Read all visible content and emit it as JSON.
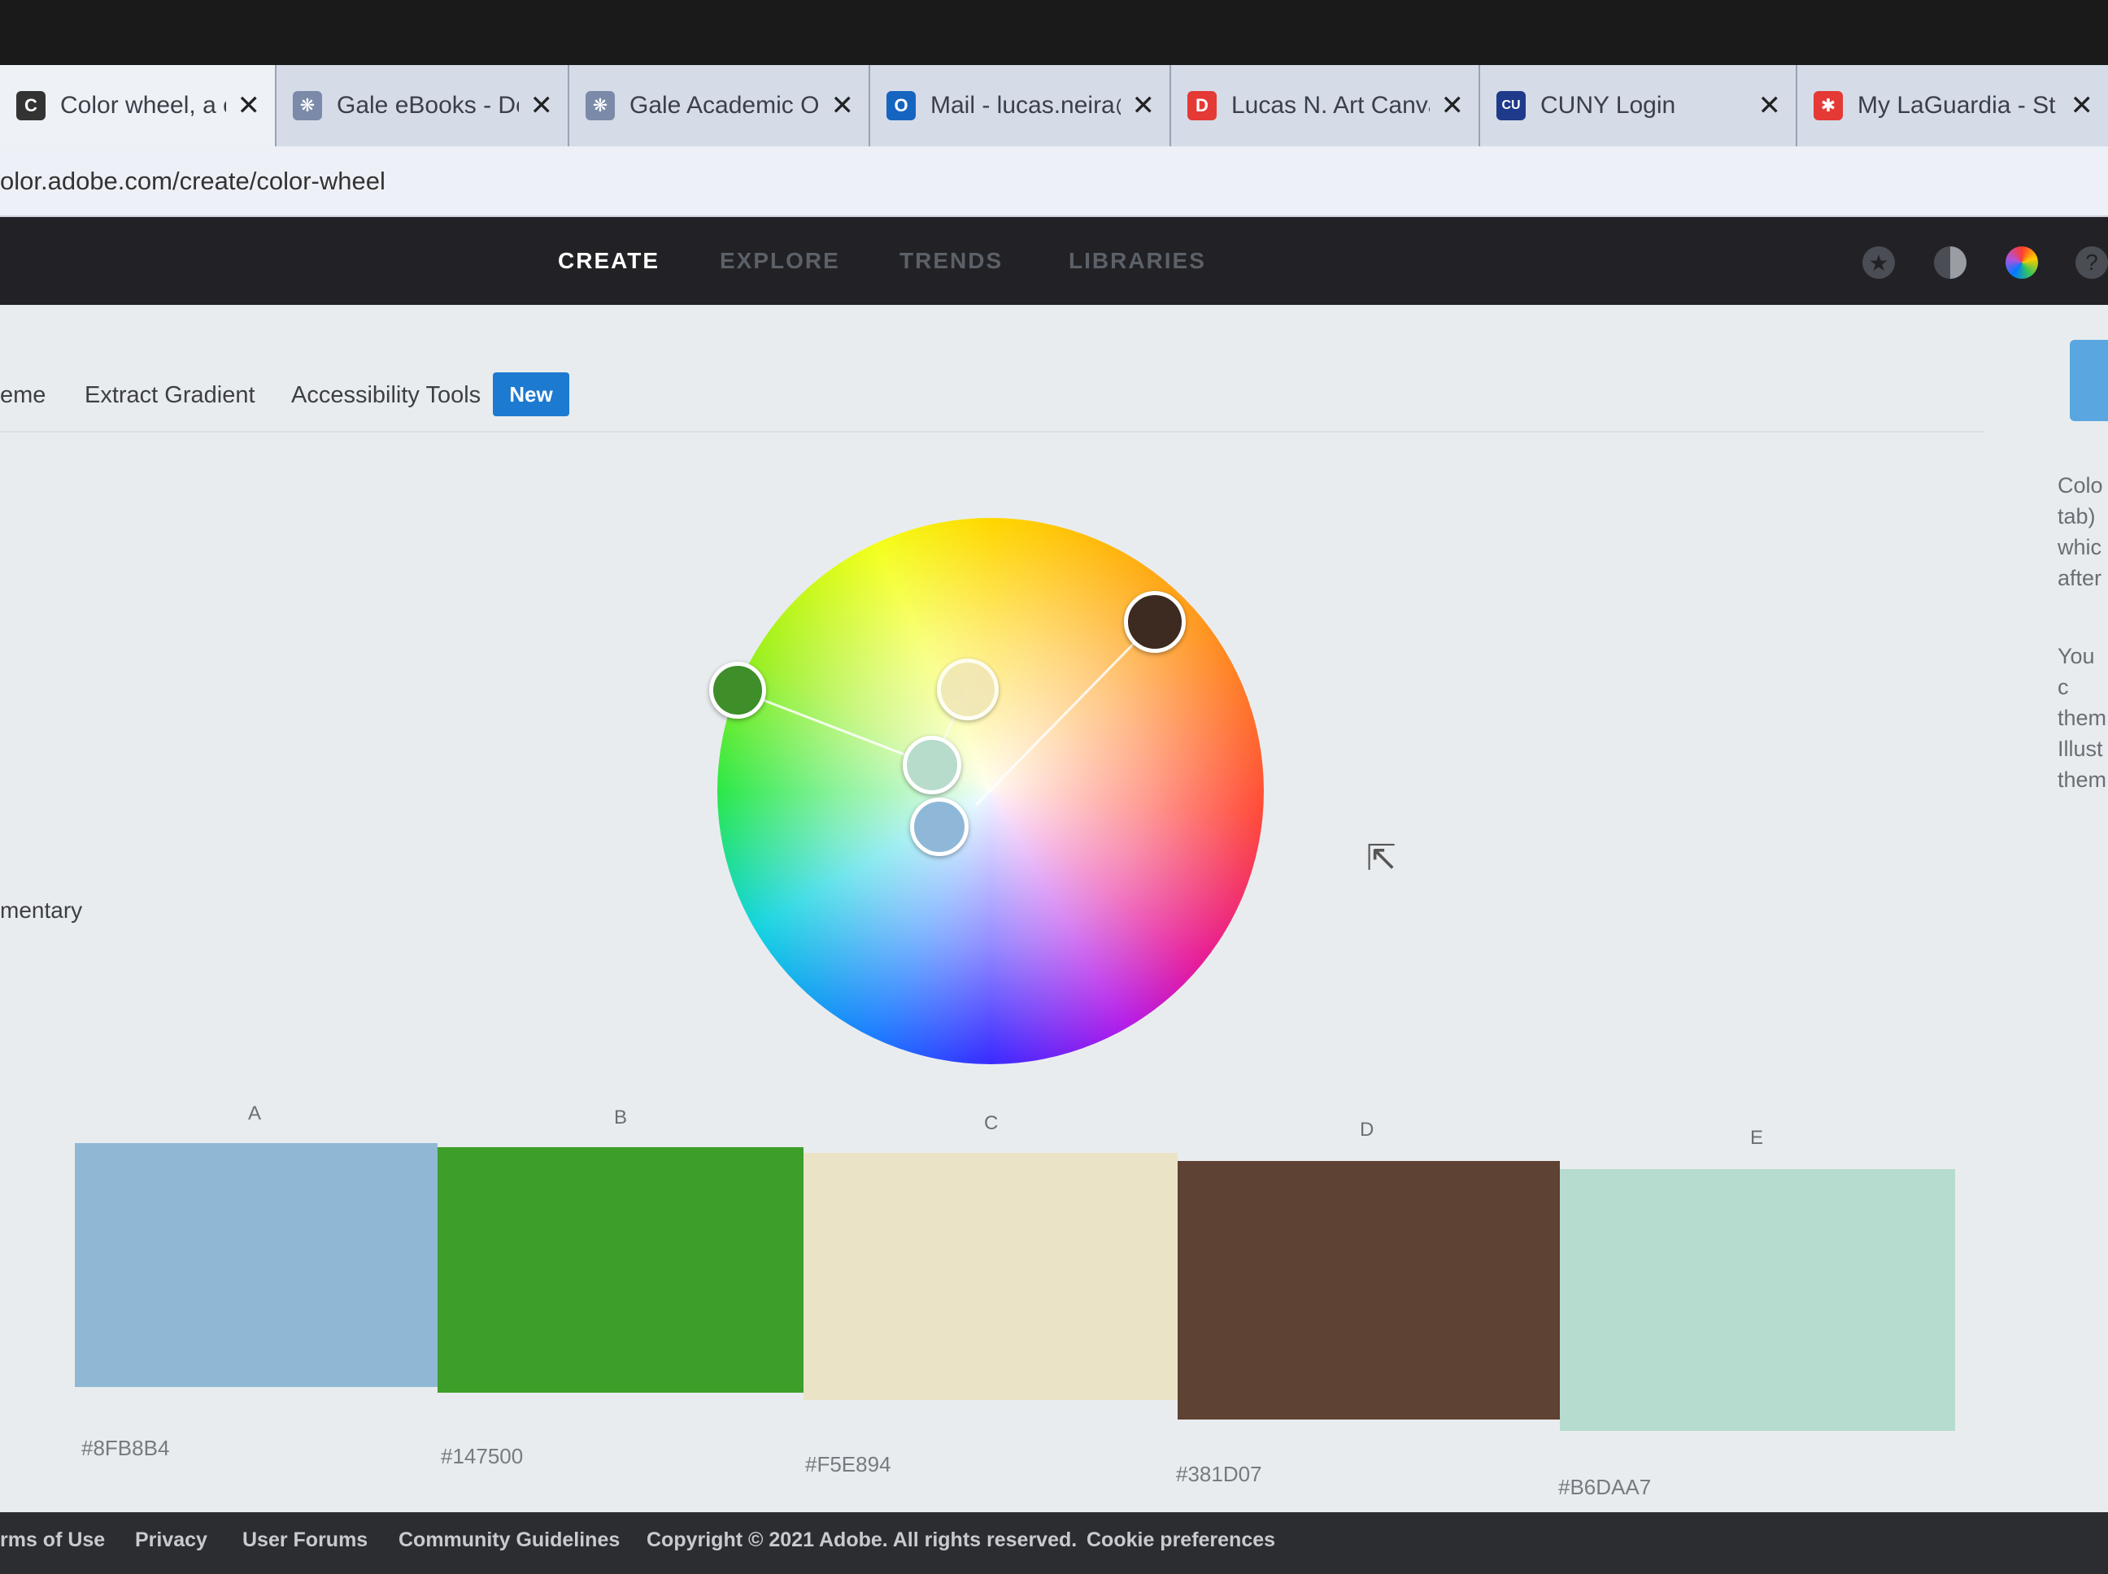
{
  "browser": {
    "tabs": [
      {
        "title": "Color wheel, a colc",
        "favicon": "adobe-color-favicon",
        "fav_color": "#333333",
        "fav_char": "C",
        "active": true
      },
      {
        "title": "Gale eBooks - Doc",
        "favicon": "gale-favicon",
        "fav_color": "#7a8aa8",
        "fav_char": "❋",
        "active": false
      },
      {
        "title": "Gale Academic On",
        "favicon": "gale-favicon",
        "fav_color": "#7a8aa8",
        "fav_char": "❋",
        "active": false
      },
      {
        "title": "Mail - lucas.neira@",
        "favicon": "outlook-favicon",
        "fav_color": "#1565c0",
        "fav_char": "O",
        "active": false
      },
      {
        "title": "Lucas N. Art Canva",
        "favicon": "d-favicon",
        "fav_color": "#e53935",
        "fav_char": "D",
        "active": false
      },
      {
        "title": "CUNY Login",
        "favicon": "cuny-favicon",
        "fav_color": "#1f3a8a",
        "fav_char": "CU",
        "active": false
      },
      {
        "title": "My LaGuardia - St",
        "favicon": "laguardia-favicon",
        "fav_color": "#e53935",
        "fav_char": "✱",
        "active": false
      }
    ],
    "close_glyph": "✕",
    "url": "olor.adobe.com/create/color-wheel"
  },
  "nav": {
    "items": [
      "CREATE",
      "EXPLORE",
      "TRENDS",
      "LIBRARIES"
    ],
    "active": "CREATE",
    "icons": [
      "star-icon",
      "moon-icon",
      "color-wheel-icon",
      "help-icon"
    ]
  },
  "subnav": {
    "items": [
      "eme",
      "Extract Gradient",
      "Accessibility Tools"
    ],
    "badge": "New"
  },
  "left_label": "mentary",
  "right_copy": {
    "para1": [
      "Colo",
      "tab)",
      "whic",
      "after"
    ],
    "para2": [
      "You c",
      "them",
      "Illust",
      "them"
    ]
  },
  "swatches": [
    {
      "label": "A",
      "hex": "#8FB8B4",
      "color": "#8fb8d4"
    },
    {
      "label": "B",
      "hex": "#147500",
      "color": "#3e9e2a"
    },
    {
      "label": "C",
      "hex": "#F5E894",
      "color": "#ebe3c6"
    },
    {
      "label": "D",
      "hex": "#381D07",
      "color": "#5e4233"
    },
    {
      "label": "E",
      "hex": "#B6DAA7",
      "color": "#b6dccf"
    }
  ],
  "footer": {
    "links": [
      "rms of Use",
      "Privacy",
      "User Forums",
      "Community Guidelines",
      "Copyright © 2021 Adobe. All rights reserved.",
      "Cookie preferences"
    ]
  },
  "colors": {
    "nav_bg": "#222226",
    "accent": "#1c7ad0",
    "footer_bg": "#2c2d31"
  }
}
